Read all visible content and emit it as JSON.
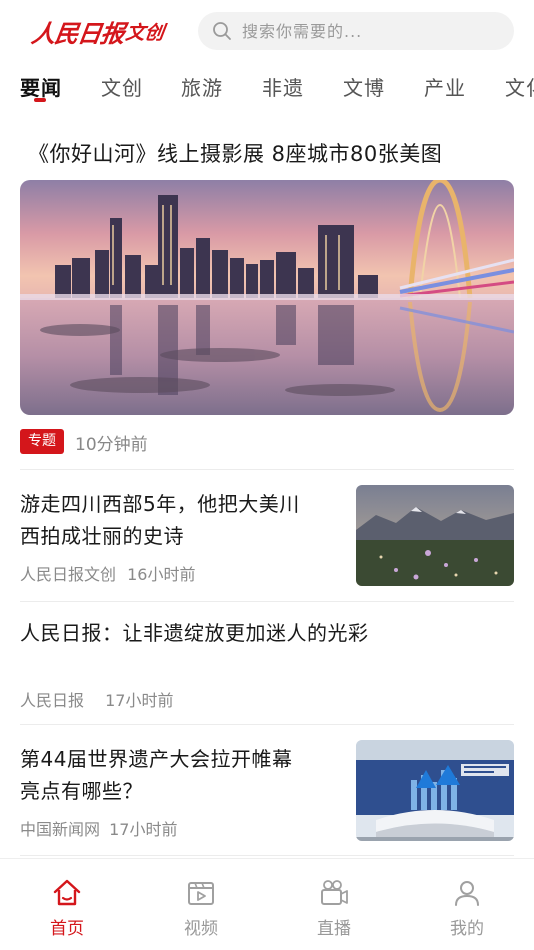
{
  "header": {
    "logo_main": "人民日报",
    "logo_sub": "文创",
    "search_placeholder": "搜索你需要的..."
  },
  "tabs": [
    {
      "label": "要闻",
      "active": true
    },
    {
      "label": "文创",
      "active": false
    },
    {
      "label": "旅游",
      "active": false
    },
    {
      "label": "非遗",
      "active": false
    },
    {
      "label": "文博",
      "active": false
    },
    {
      "label": "产业",
      "active": false
    },
    {
      "label": "文化",
      "active": false
    }
  ],
  "featured": {
    "title": "《你好山河》线上摄影展 8座城市80张美图",
    "tag": "专题",
    "time": "10分钟前"
  },
  "news": [
    {
      "title_line1": "游走四川西部5年，他把大美川",
      "title_line2": "西拍成壮丽的史诗",
      "source": "人民日报文创",
      "time": "16小时前"
    },
    {
      "title_line1": "人民日报：让非遗绽放更加迷人的光彩",
      "source": "人民日报",
      "time": "17小时前"
    },
    {
      "title_line1": "第44届世界遗产大会拉开帷幕",
      "title_line2": "亮点有哪些？",
      "source": "中国新闻网",
      "time": "17小时前"
    }
  ],
  "bottom_nav": [
    {
      "label": "首页",
      "icon": "home-icon",
      "active": true
    },
    {
      "label": "视频",
      "icon": "video-icon",
      "active": false
    },
    {
      "label": "直播",
      "icon": "live-camera-icon",
      "active": false
    },
    {
      "label": "我的",
      "icon": "profile-icon",
      "active": false
    }
  ],
  "colors": {
    "accent": "#d4161b",
    "muted": "#999999"
  }
}
